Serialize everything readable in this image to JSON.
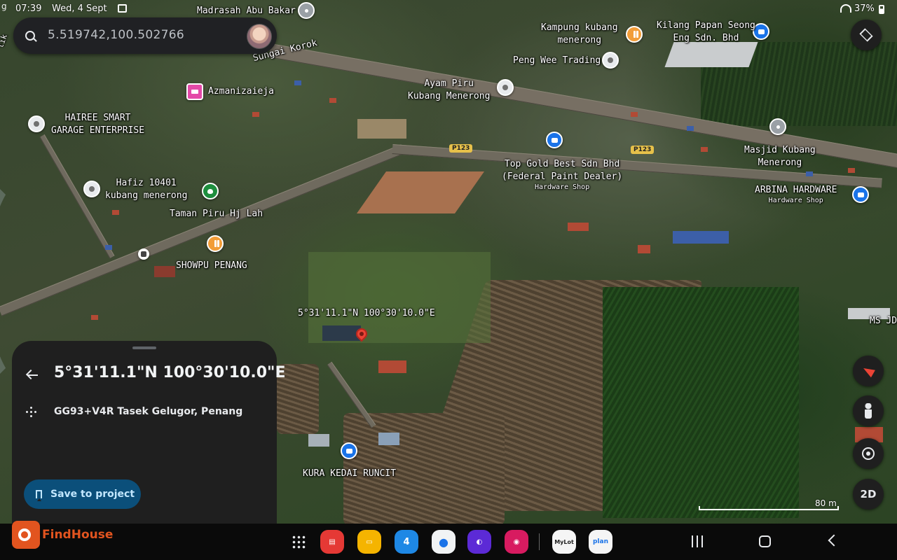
{
  "status_bar": {
    "time": "07:39",
    "date": "Wed, 4 Sept",
    "battery": "37%"
  },
  "search": {
    "query": "5.519742,100.502766"
  },
  "map": {
    "labels": {
      "madrasah": "Madrasah Abu Bakar",
      "sungai": "Sungai Korok",
      "kampung": "Kampung kubang\nmenerong",
      "kilang": "Kilang Papan Seong\nEng Sdn. Bhd",
      "pengwee": "Peng Wee Trading",
      "ayam": "Ayam Piru\nKubang Menerong",
      "azmani": "Azmanizaieja",
      "hairee": "HAIREE SMART\nGARAGE ENTERPRISE",
      "masjid": "Masjid Kubang\nMenerong",
      "topgold": "Top Gold Best Sdn Bhd\n(Federal Paint Dealer)",
      "topgold_sub": "Hardware Shop",
      "arbina": "ARBINA HARDWARE",
      "arbina_sub": "Hardware Shop",
      "hafiz": "Hafiz 10401\nkubang menerong",
      "taman": "Taman Piru Hj Lah",
      "showpu": "SHOWPU PENANG",
      "msjd": "MS JD",
      "pin_coord": "5°31'11.1\"N 100°30'10.0\"E",
      "kura": "KURA KEDAI RUNCIT",
      "left_edge": "tik"
    },
    "road_shields": [
      "P123",
      "P123"
    ],
    "scale": "80 m"
  },
  "controls": {
    "mode_toggle": "2D"
  },
  "sheet": {
    "title": "5°31'11.1\"N 100°30'10.0\"E",
    "plus_code": "GG93+V4R Tasek Gelugor, Penang",
    "save_label": "Save to project"
  },
  "dock": {
    "calendar_day": "4",
    "mylot": "MyLot",
    "plan": "plan"
  },
  "watermark": {
    "brand": "FindHouse"
  },
  "colors": {
    "accent_button": "#0b4f7a",
    "sheet_bg": "#1f1f1f",
    "pin_red": "#ea4335",
    "brand": "#e2541f"
  }
}
